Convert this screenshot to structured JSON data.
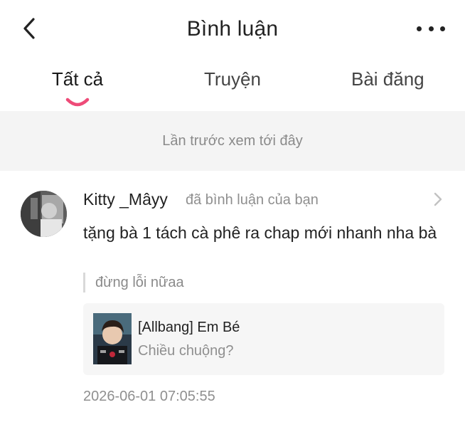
{
  "header": {
    "title": "Bình luận",
    "back_icon": "chevron-left-icon",
    "more_icon": "more-horizontal-icon"
  },
  "tabs": [
    {
      "label": "Tất cả",
      "active": true
    },
    {
      "label": "Truyện",
      "active": false
    },
    {
      "label": "Bài đăng",
      "active": false
    }
  ],
  "colors": {
    "accent": "#ee4b78",
    "banner_bg": "#f4f4f4",
    "muted_text": "#8f8f8f"
  },
  "banner": {
    "text": "Lần trước xem tới đây"
  },
  "comment": {
    "username": "Kitty _Mâyy",
    "action": "đã bình luận của bạn",
    "text": "tặng bà 1 tách cà phê ra chap mới nhanh nha bà",
    "quoted_reply": "đừng lỗi nữaa",
    "story": {
      "title": "[Allbang] Em Bé",
      "subtitle": "Chiều chuộng?"
    },
    "timestamp": "2026-06-01 07:05:55"
  }
}
